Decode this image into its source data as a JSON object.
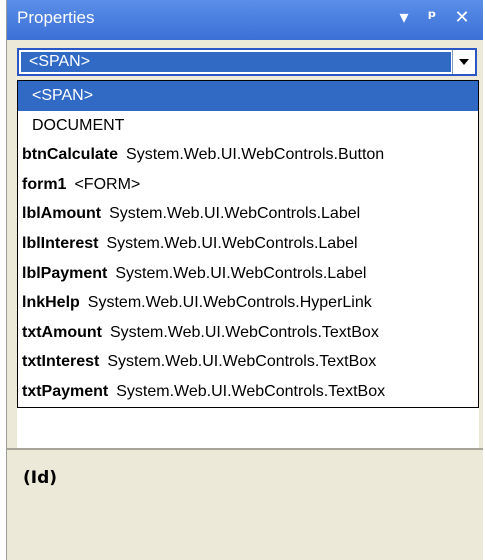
{
  "window": {
    "title": "Properties"
  },
  "titlebar_buttons": {
    "dropdown_icon": "▾",
    "pin_icon": "ᵠ",
    "close_icon": "✕"
  },
  "combo": {
    "value": "<SPAN>"
  },
  "dropdown": {
    "items": [
      {
        "name": "<SPAN>",
        "type": "",
        "selected": true
      },
      {
        "name": "DOCUMENT",
        "type": ""
      },
      {
        "name": "btnCalculate",
        "type": "System.Web.UI.WebControls.Button"
      },
      {
        "name": "form1",
        "type": "<FORM>"
      },
      {
        "name": "lblAmount",
        "type": "System.Web.UI.WebControls.Label"
      },
      {
        "name": "lblInterest",
        "type": "System.Web.UI.WebControls.Label"
      },
      {
        "name": "lblPayment",
        "type": "System.Web.UI.WebControls.Label"
      },
      {
        "name": "lnkHelp",
        "type": "System.Web.UI.WebControls.HyperLink"
      },
      {
        "name": "txtAmount",
        "type": "System.Web.UI.WebControls.TextBox"
      },
      {
        "name": "txtInterest",
        "type": "System.Web.UI.WebControls.TextBox"
      },
      {
        "name": "txtPayment",
        "type": "System.Web.UI.WebControls.TextBox"
      }
    ]
  },
  "description": {
    "title": "(Id)"
  }
}
